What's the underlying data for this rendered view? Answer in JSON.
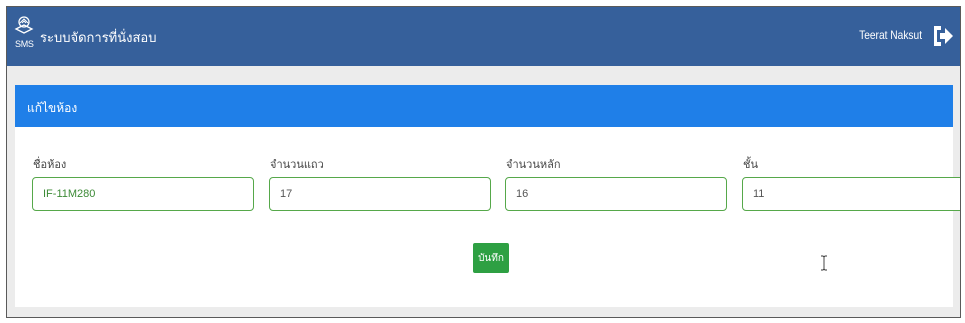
{
  "header": {
    "logo_text": "SMS",
    "app_title": "ระบบจัดการที่นั่งสอบ",
    "user_name": "Teerat Naksut",
    "logout_icon": "sign-out-icon"
  },
  "panel": {
    "title": "แก้ไขห้อง",
    "fields": [
      {
        "label": "ชื่อห้อง",
        "value": "IF-11M280"
      },
      {
        "label": "จำนวนแถว",
        "value": "17"
      },
      {
        "label": "จำนวนหลัก",
        "value": "16"
      },
      {
        "label": "ชั้น",
        "value": "11"
      }
    ],
    "save_label": "บันทึก"
  },
  "colors": {
    "topbar": "#36609b",
    "panel_header": "#1f7fe8",
    "input_border": "#56a84a",
    "save_button": "#2ea043",
    "background": "#ececec"
  }
}
